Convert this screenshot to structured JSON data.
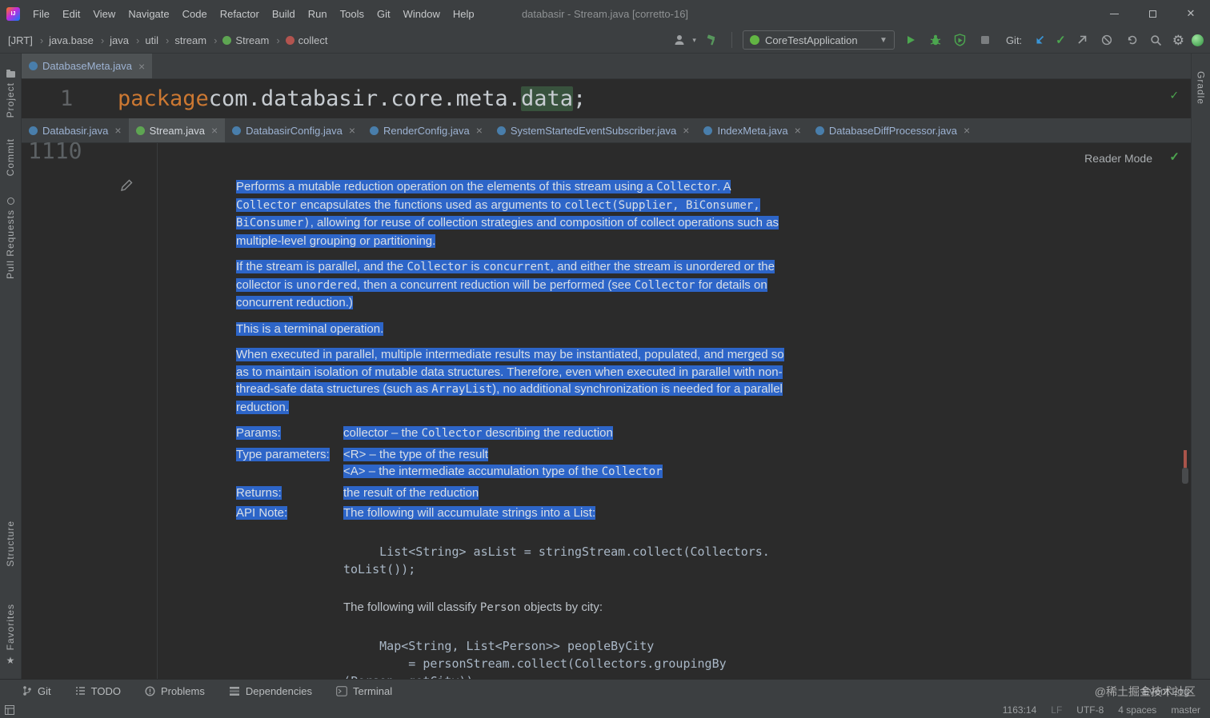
{
  "colors": {
    "chrome": "#3c3f41",
    "editor": "#2b2b2b",
    "sel": "#2d65c8",
    "kw": "#cc7832",
    "code": "#a9b7c6",
    "hl": "#38523d",
    "tabsel": "#4e5254",
    "modblue": "#9db3d3",
    "green": "#4ca64f"
  },
  "titlebar": {
    "title": "databasir - Stream.java [corretto-16]",
    "menus": [
      {
        "label": "File"
      },
      {
        "label": "Edit"
      },
      {
        "label": "View"
      },
      {
        "label": "Navigate"
      },
      {
        "label": "Code"
      },
      {
        "label": "Refactor"
      },
      {
        "label": "Build"
      },
      {
        "label": "Run"
      },
      {
        "label": "Tools"
      },
      {
        "label": "Git"
      },
      {
        "label": "Window"
      },
      {
        "label": "Help"
      }
    ]
  },
  "navbar": {
    "crumbs": [
      {
        "label": "[JRT]"
      },
      {
        "label": "java.base"
      },
      {
        "label": "java"
      },
      {
        "label": "util"
      },
      {
        "label": "stream"
      },
      {
        "label": "Stream",
        "kind": "interface"
      },
      {
        "label": "collect",
        "kind": "method"
      }
    ],
    "run_config": "CoreTestApplication",
    "git_label": "Git:",
    "icons": [
      "profile-icon",
      "build-hammer-icon",
      "run-icon",
      "debug-icon",
      "coverage-icon",
      "stop-icon",
      "update-project-icon",
      "commit-check-icon",
      "push-icon",
      "no-entry-icon",
      "rollback-icon",
      "search-icon",
      "settings-gear-icon",
      "code-with-me-icon"
    ]
  },
  "editor_top": {
    "tab": {
      "label": "DatabaseMeta.java",
      "kind": "class",
      "close": "×"
    },
    "line_number": "1",
    "code": {
      "keyword": "package",
      "body": " com.databasir.core.meta.",
      "highlight": "data",
      "tail": ";"
    }
  },
  "tabs": [
    {
      "label": "Databasir.java",
      "kind": "class",
      "modified": true,
      "close": "×"
    },
    {
      "label": "Stream.java",
      "kind": "interface",
      "active": true,
      "close": "×"
    },
    {
      "label": "DatabasirConfig.java",
      "kind": "class",
      "modified": true,
      "close": "×"
    },
    {
      "label": "RenderConfig.java",
      "kind": "class",
      "modified": true,
      "close": "×"
    },
    {
      "label": "SystemStartedEventSubscriber.java",
      "kind": "class",
      "modified": true,
      "close": "×"
    },
    {
      "label": "IndexMeta.java",
      "kind": "class",
      "modified": true,
      "close": "×"
    },
    {
      "label": "DatabaseDiffProcessor.java",
      "kind": "class",
      "modified": true,
      "close": "×"
    }
  ],
  "reader": {
    "mode_label": "Reader Mode",
    "gutter_line": "1110"
  },
  "doc": {
    "p1": [
      {
        "t": "Performs a mutable reduction operation on the elements of this stream using a "
      },
      {
        "c": "Collector"
      },
      {
        "t": ". A "
      },
      {
        "c": "Collector"
      },
      {
        "t": " encapsulates the functions used as arguments to "
      },
      {
        "c": "collect(Supplier, BiConsumer, BiConsumer)"
      },
      {
        "t": ", allowing for reuse of collection strategies and composition of collect operations such as multiple-level grouping or partitioning."
      }
    ],
    "p2": [
      {
        "t": "If the stream is parallel, and the "
      },
      {
        "c": "Collector"
      },
      {
        "t": " is "
      },
      {
        "c": "concurrent"
      },
      {
        "t": ", and either the stream is unordered or the collector is "
      },
      {
        "c": "unordered"
      },
      {
        "t": ", then a concurrent reduction will be performed (see "
      },
      {
        "c": "Collector"
      },
      {
        "t": " for details on concurrent reduction.)"
      }
    ],
    "p3": [
      {
        "t": "This is a terminal operation."
      }
    ],
    "p4": [
      {
        "t": "When executed in parallel, multiple intermediate results may be instantiated, populated, and merged so as to maintain isolation of mutable data structures. Therefore, even when executed in parallel with non-thread-safe data structures (such as "
      },
      {
        "c": "ArrayList"
      },
      {
        "t": "), no additional synchronization is needed for a parallel reduction."
      }
    ],
    "params_label": "Params:",
    "params_value": [
      {
        "t": "collector – the "
      },
      {
        "c": "Collector"
      },
      {
        "t": " describing the reduction"
      }
    ],
    "type_label": "Type parameters:",
    "type_v1": [
      {
        "t": "<R> – the type of the result"
      }
    ],
    "type_v2": [
      {
        "t": "<A> – the intermediate accumulation type of the "
      },
      {
        "c": "Collector"
      }
    ],
    "returns_label": "Returns:",
    "returns_value": [
      {
        "t": "the result of the reduction"
      }
    ],
    "api_label": "API Note:",
    "api_value": [
      {
        "t": "The following will accumulate strings into a List:"
      }
    ],
    "code1": "     List<String> asList = stringStream.collect(Collectors.\ntoList());",
    "classify": [
      {
        "t": "The following will classify "
      },
      {
        "c": "Person"
      },
      {
        "t": " objects by city:"
      }
    ],
    "code2": "     Map<String, List<Person>> peopleByCity\n         = personStream.collect(Collectors.groupingBy\n(Person::getCity));"
  },
  "left_stripe": {
    "top": [
      {
        "label": "Project",
        "icon": "folder"
      },
      {
        "label": "Commit"
      },
      {
        "label": "Pull Requests",
        "icon": "pin"
      }
    ],
    "bottom": [
      {
        "label": "Structure"
      },
      {
        "label": "Favorites",
        "icon": "star"
      }
    ]
  },
  "right_stripe": [
    {
      "label": "Gradle"
    }
  ],
  "toolbuttons": {
    "items": [
      {
        "label": "Git"
      },
      {
        "label": "TODO"
      },
      {
        "label": "Problems"
      },
      {
        "label": "Dependencies"
      },
      {
        "label": "Terminal"
      }
    ],
    "event_log": "Event Log",
    "watermark": "@稀土掘金技术社区"
  },
  "statusbar": {
    "right": [
      {
        "label": "1163:14"
      },
      {
        "label": "LF",
        "kind": "dim"
      },
      {
        "label": "UTF-8"
      },
      {
        "label": "4 spaces"
      },
      {
        "label": "master"
      }
    ]
  }
}
